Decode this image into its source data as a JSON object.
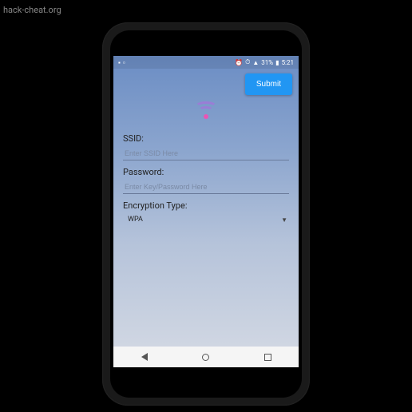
{
  "watermark": "hack-cheat.org",
  "status_bar": {
    "battery_text": "31%",
    "time": "5:21"
  },
  "submit": {
    "label": "Submit"
  },
  "form": {
    "ssid": {
      "label": "SSID:",
      "placeholder": "Enter SSID Here",
      "value": ""
    },
    "password": {
      "label": "Password:",
      "placeholder": "Enter Key/Password Here",
      "value": ""
    },
    "encryption": {
      "label": "Encryption Type:",
      "selected": "WPA"
    }
  },
  "icons": {
    "wifi": "wifi-icon",
    "alarm": "alarm-icon",
    "signal": "signal-icon",
    "battery": "battery-icon"
  }
}
